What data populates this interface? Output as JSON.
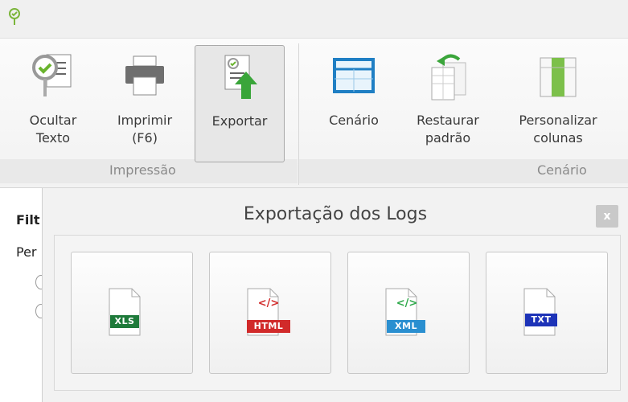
{
  "ribbon": {
    "buttons": [
      {
        "label1": "Ocultar",
        "label2": "Texto",
        "icon": "hide-text-icon"
      },
      {
        "label1": "Imprimir",
        "label2": "(F6)",
        "icon": "printer-icon"
      },
      {
        "label1": "Exportar",
        "label2": "",
        "icon": "export-icon"
      },
      {
        "label1": "Cenário",
        "label2": "",
        "icon": "scenario-icon"
      },
      {
        "label1": "Restaurar",
        "label2": "padrão",
        "icon": "restore-default-icon"
      },
      {
        "label1": "Personalizar",
        "label2": "colunas",
        "icon": "customize-columns-icon"
      }
    ],
    "groups": {
      "impressao": "Impressão",
      "cenario": "Cenário"
    }
  },
  "left_panel": {
    "filter_label": "Filt",
    "period_label": "Per"
  },
  "popup": {
    "title": "Exportação dos Logs",
    "close": "x",
    "formats": [
      {
        "name": "XLS",
        "code": "",
        "color": "#1e7a3a"
      },
      {
        "name": "HTML",
        "code": "</>",
        "color": "#d12a2a"
      },
      {
        "name": "XML",
        "code": "</>",
        "color": "#2a8fd0"
      },
      {
        "name": "TXT",
        "code": "",
        "color": "#1d33b8"
      }
    ]
  },
  "colors": {
    "accent": "#2a8fd0",
    "export_arrow": "#3aa53a"
  }
}
